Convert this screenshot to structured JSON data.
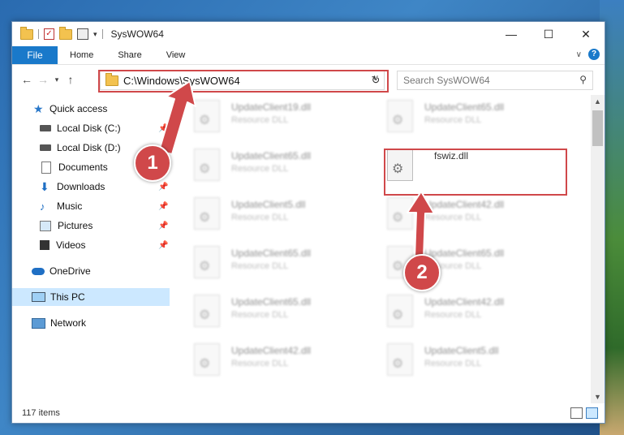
{
  "window": {
    "title": "SysWOW64"
  },
  "ribbon": {
    "file": "File",
    "home": "Home",
    "share": "Share",
    "view": "View"
  },
  "title_buttons": {
    "minimize": "—",
    "maximize": "☐",
    "close": "✕"
  },
  "address": {
    "path": "C:\\Windows\\SysWOW64"
  },
  "search": {
    "placeholder": "Search SysWOW64"
  },
  "nav": {
    "quick_access": "Quick access",
    "items": [
      {
        "label": "Local Disk (C:)",
        "pinned": true
      },
      {
        "label": "Local Disk (D:)",
        "pinned": true
      },
      {
        "label": "Documents",
        "pinned": true
      },
      {
        "label": "Downloads",
        "pinned": true
      },
      {
        "label": "Music",
        "pinned": true
      },
      {
        "label": "Pictures",
        "pinned": true
      },
      {
        "label": "Videos",
        "pinned": true
      }
    ],
    "onedrive": "OneDrive",
    "this_pc": "This PC",
    "network": "Network"
  },
  "files": [
    {
      "name": "UpdateClient19.dll",
      "desc": "Resource DLL"
    },
    {
      "name": "UpdateClient65.dll",
      "desc": "Resource DLL"
    },
    {
      "name": "UpdateClient65.dll",
      "desc": "Resource DLL"
    },
    {
      "name": "fswiz.dll",
      "desc": ""
    },
    {
      "name": "UpdateClient5.dll",
      "desc": "Resource DLL"
    },
    {
      "name": "UpdateClient42.dll",
      "desc": "Resource DLL"
    },
    {
      "name": "UpdateClient65.dll",
      "desc": "Resource DLL"
    },
    {
      "name": "UpdateClient65.dll",
      "desc": "Resource DLL"
    },
    {
      "name": "UpdateClient65.dll",
      "desc": "Resource DLL"
    },
    {
      "name": "UpdateClient42.dll",
      "desc": "Resource DLL"
    },
    {
      "name": "UpdateClient42.dll",
      "desc": "Resource DLL"
    },
    {
      "name": "UpdateClient5.dll",
      "desc": "Resource DLL"
    }
  ],
  "status": {
    "count": "117 items"
  },
  "annotations": {
    "step1": "1",
    "step2": "2"
  },
  "colors": {
    "accent": "#1979ca",
    "highlight": "#d0484a",
    "selection": "#cce8ff"
  }
}
